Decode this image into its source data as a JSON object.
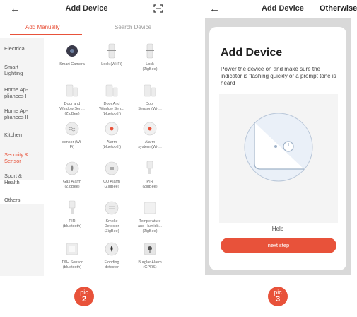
{
  "left_screen": {
    "title": "Add Device",
    "tabs": {
      "manual": "Add Manually",
      "search": "Search Device"
    },
    "categories": [
      "Electrical",
      "Smart\nLighting",
      "Home Ap-\npliances I",
      "Home Ap-\npliances II",
      "Kitchen",
      "Security &\nSensor",
      "Sport &\nHealth",
      "Others"
    ],
    "active_category_index": 5,
    "devices": [
      {
        "label": "Smart Camera",
        "icon": "camera-icon"
      },
      {
        "label": "Lock (Wi-Fi)",
        "icon": "lock-icon"
      },
      {
        "label": "Lock\n(ZigBee)",
        "icon": "lock-icon"
      },
      {
        "label": "Door and\nWindow Sen...\n(ZigBee)",
        "icon": "door-sensor-icon"
      },
      {
        "label": "Door And\nWindow Sen...\n(bluetooth)",
        "icon": "door-sensor-icon"
      },
      {
        "label": "Door\nSensor (Wi-...",
        "icon": "door-sensor-icon"
      },
      {
        "label": "sensor (Wi-\nFi)",
        "icon": "sensor-icon"
      },
      {
        "label": "Alarm\n(bluetooth)",
        "icon": "alarm-icon"
      },
      {
        "label": "Alarm\nsystem (Wi-...",
        "icon": "alarm-icon"
      },
      {
        "label": "Gas Alarm\n(ZigBee)",
        "icon": "gas-alarm-icon"
      },
      {
        "label": "CO Alarm\n(ZigBee)",
        "icon": "co-alarm-icon"
      },
      {
        "label": "PIR\n(ZigBee)",
        "icon": "pir-icon"
      },
      {
        "label": "PIR\n(bluetooth)",
        "icon": "pir-icon"
      },
      {
        "label": "Smoke\nDetector\n(ZigBee)",
        "icon": "smoke-detector-icon"
      },
      {
        "label": "Temperature\nand Humidit...\n(ZigBee)",
        "icon": "temperature-icon"
      },
      {
        "label": "T&H Sensor\n(bluetooth)",
        "icon": "th-sensor-icon"
      },
      {
        "label": "Flooding\ndetector",
        "icon": "flood-icon"
      },
      {
        "label": "Burglar Alarm\n(GPRS)",
        "icon": "burglar-alarm-icon"
      }
    ],
    "badge": {
      "line1": "pic",
      "line2": "2"
    }
  },
  "right_screen": {
    "title": "Add Device",
    "other_label": "Otherwise",
    "heading": "Add Device",
    "description": "Power the device on and make sure the indicator is flashing quickly or a prompt tone is heard",
    "help_label": "Help",
    "next_button": "next step",
    "badge": {
      "line1": "pic",
      "line2": "3"
    }
  },
  "colors": {
    "accent": "#e8523a",
    "sidebar_bg": "#f4f4f4",
    "frame_bg": "#d9d9d9"
  }
}
